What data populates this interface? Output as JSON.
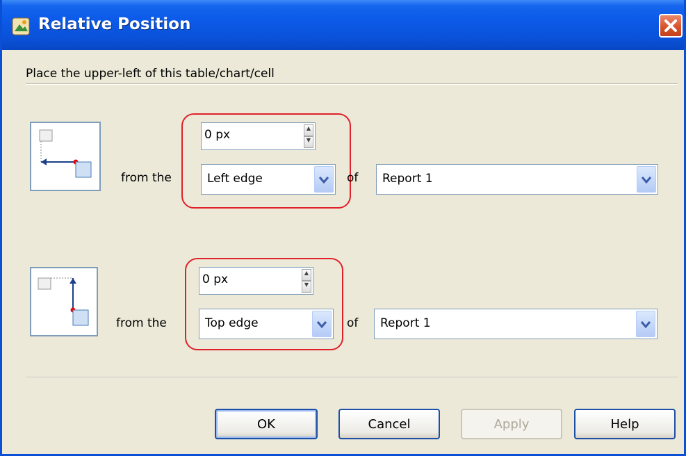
{
  "window": {
    "title": "Relative Position"
  },
  "caption": "Place the upper-left of this table/chart/cell",
  "rows": [
    {
      "from_label": "from the",
      "offset_value": "0 px",
      "edge_value": "Left edge",
      "of_label": "of",
      "target_value": "Report 1"
    },
    {
      "from_label": "from the",
      "offset_value": "0 px",
      "edge_value": "Top edge",
      "of_label": "of",
      "target_value": "Report 1"
    }
  ],
  "buttons": {
    "ok": "OK",
    "cancel": "Cancel",
    "apply": "Apply",
    "help": "Help"
  },
  "colors": {
    "title_bar": "#0a52d9",
    "highlight": "#e0202a",
    "dialog_bg": "#ece9d8"
  },
  "icons": {
    "app": "app-icon",
    "close": "close-icon",
    "dropdown": "chevron-down-icon",
    "spin": "spinner-arrows-icon"
  }
}
